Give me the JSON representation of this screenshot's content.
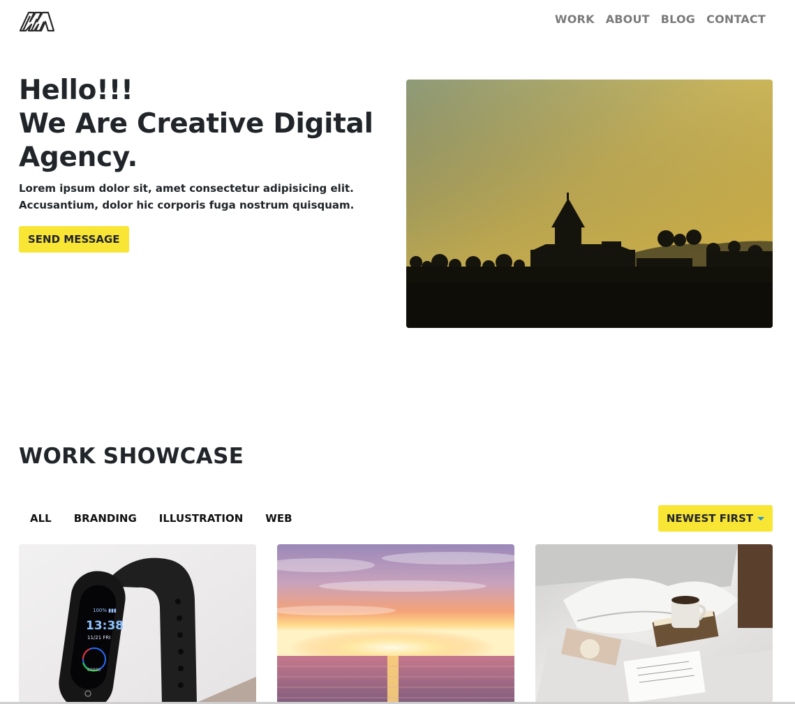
{
  "nav": {
    "logo_icon": "stacked-m-logo-icon",
    "links": [
      "WORK",
      "ABOUT",
      "BLOG",
      "CONTACT"
    ]
  },
  "hero": {
    "title_line1": "Hello!!!",
    "title_line2": "We Are Creative Digital",
    "title_line3": "Agency.",
    "subtitle_line1": "Lorem ipsum dolor sit, amet consectetur adipisicing elit.",
    "subtitle_line2": "Accusantium, dolor hic corporis fuga nostrum quisquam.",
    "cta_label": "SEND MESSAGE",
    "image": "sunset-church-silhouette-photo"
  },
  "showcase": {
    "title": "WORK SHOWCASE",
    "filters": [
      "ALL",
      "BRANDING",
      "ILLUSTRATION",
      "WEB"
    ],
    "sort_label": "NEWEST FIRST",
    "sort_icon": "caret-down-icon",
    "cards": [
      {
        "image": "fitness-band-photo"
      },
      {
        "image": "sea-sunset-photo"
      },
      {
        "image": "bed-coffee-book-photo"
      }
    ]
  },
  "colors": {
    "accent": "#f9e534",
    "text": "#212529",
    "nav_text": "#7a7a7a",
    "caret": "#1e90d6"
  }
}
